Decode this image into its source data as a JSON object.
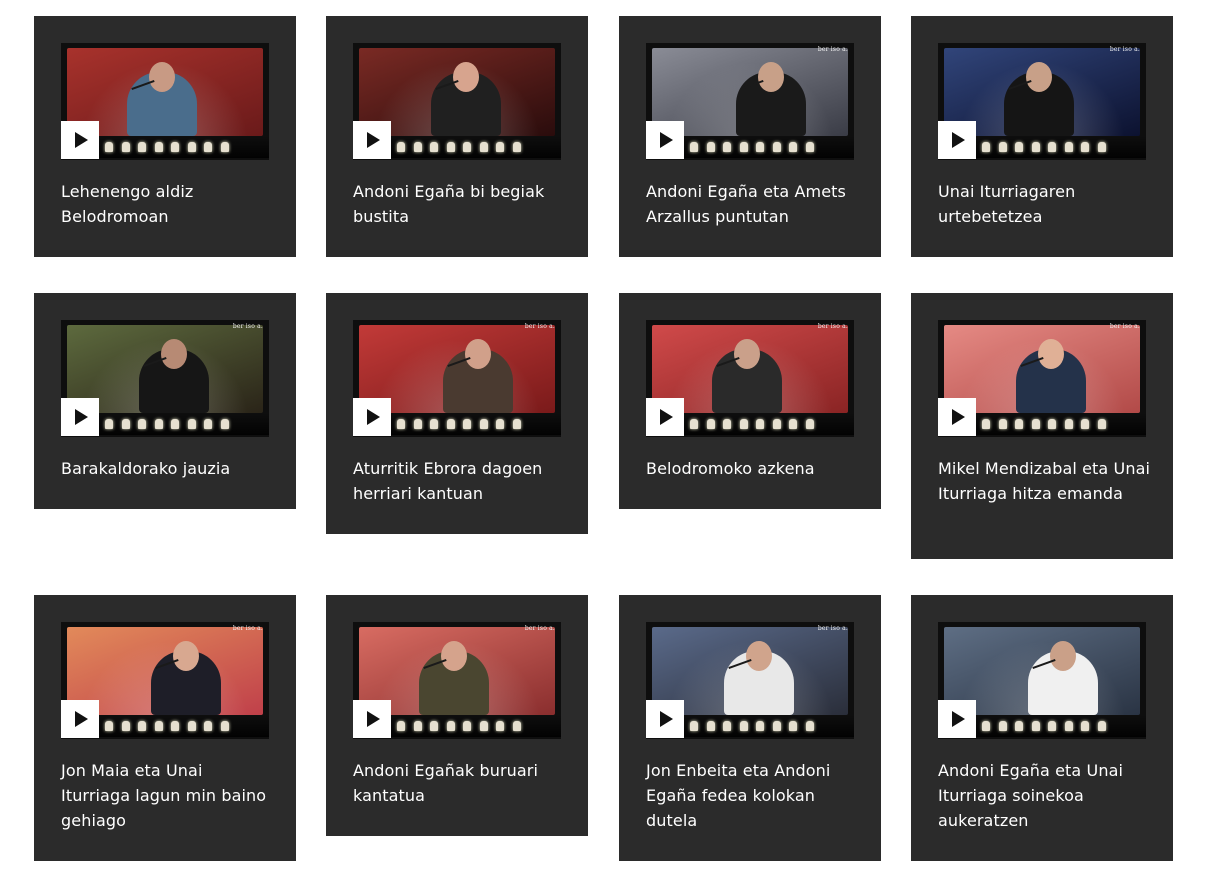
{
  "videos": [
    {
      "title": "Lehenengo aldiz Belodromoan",
      "watermark": "",
      "theme": {
        "bg1": "#a8322c",
        "bg2": "#6a1a1a",
        "skin": "#c89a84",
        "shirt": "#4a6d8c"
      },
      "icon": "play-icon"
    },
    {
      "title": "Andoni Egaña bi begiak bustita",
      "watermark": "",
      "theme": {
        "bg1": "#7a2a24",
        "bg2": "#2a0c0c",
        "skin": "#d7a48e",
        "shirt": "#202020"
      },
      "icon": "play-icon"
    },
    {
      "title": "Andoni Egaña eta Amets Arzallus puntutan",
      "watermark": "ber iso a.",
      "theme": {
        "bg1": "#8a8c96",
        "bg2": "#3a3c46",
        "skin": "#c8a088",
        "shirt": "#1a1a1a"
      },
      "icon": "play-icon"
    },
    {
      "title": "Unai Iturriagaren urtebetetzea",
      "watermark": "ber iso a.",
      "theme": {
        "bg1": "#31457a",
        "bg2": "#0c1230",
        "skin": "#c8a088",
        "shirt": "#151515"
      },
      "icon": "play-icon"
    },
    {
      "title": "Barakaldorako jauzia",
      "watermark": "ber iso a.",
      "theme": {
        "bg1": "#5d6a3e",
        "bg2": "#2a2418",
        "skin": "#b78a74",
        "shirt": "#161616"
      },
      "icon": "play-icon"
    },
    {
      "title": "Aturritik Ebrora dagoen herriari kantuan",
      "watermark": "ber iso a.",
      "theme": {
        "bg1": "#c23a38",
        "bg2": "#7a1a1a",
        "skin": "#d1a08a",
        "shirt": "#4a3a30"
      },
      "icon": "play-icon"
    },
    {
      "title": "Belodromoko azkena",
      "watermark": "ber iso a.",
      "theme": {
        "bg1": "#d04a4a",
        "bg2": "#8a2424",
        "skin": "#caa08a",
        "shirt": "#2a2a2a"
      },
      "icon": "play-icon"
    },
    {
      "title": "Mikel Mendizabal eta Unai Iturriaga hitza emanda",
      "watermark": "ber iso a.",
      "theme": {
        "bg1": "#e58a84",
        "bg2": "#b24a48",
        "skin": "#e0b096",
        "shirt": "#24324a"
      },
      "icon": "play-icon"
    },
    {
      "title": "Jon Maia eta Unai Iturriaga lagun min baino gehiago",
      "watermark": "ber iso a.",
      "theme": {
        "bg1": "#e28a5a",
        "bg2": "#c0404a",
        "skin": "#d8a890",
        "shirt": "#1e1e28"
      },
      "icon": "play-icon"
    },
    {
      "title": "Andoni Egañak buruari kantatua",
      "watermark": "ber iso a.",
      "theme": {
        "bg1": "#d86c62",
        "bg2": "#8a2e2e",
        "skin": "#d5a38c",
        "shirt": "#4a4630"
      },
      "icon": "play-icon"
    },
    {
      "title": "Jon Enbeita eta Andoni Egaña fedea kolokan dutela",
      "watermark": "ber iso a.",
      "theme": {
        "bg1": "#5a6a8a",
        "bg2": "#2a2e3a",
        "skin": "#d0a48c",
        "shirt": "#e8e8e8"
      },
      "icon": "play-icon"
    },
    {
      "title": "Andoni Egaña eta Unai Iturriaga soinekoa aukeratzen",
      "watermark": "",
      "theme": {
        "bg1": "#5e6e84",
        "bg2": "#2a3444",
        "skin": "#caa088",
        "shirt": "#f0f0f0"
      },
      "icon": "play-icon"
    }
  ]
}
